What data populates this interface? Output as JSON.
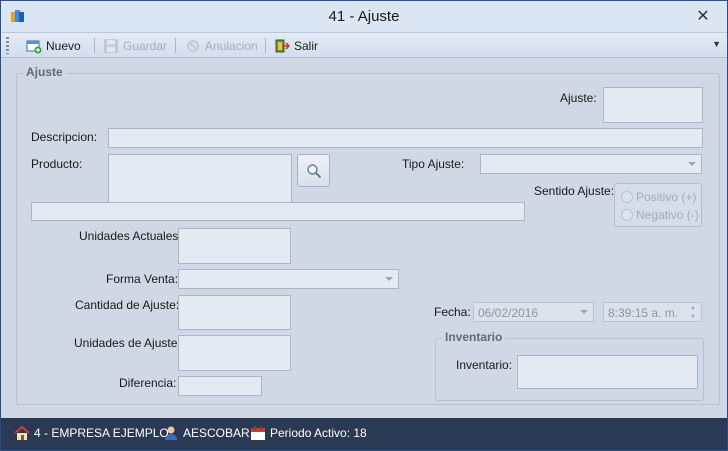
{
  "window": {
    "title": "41 - Ajuste",
    "close_glyph": "✕"
  },
  "toolbar": {
    "nuevo": "Nuevo",
    "guardar": "Guardar",
    "anulacion": "Anulacion",
    "salir": "Salir",
    "overflow_glyph": "▼"
  },
  "form": {
    "group_title": "Ajuste",
    "ajuste_label": "Ajuste:",
    "descripcion_label": "Descripcion:",
    "producto_label": "Producto:",
    "tipo_ajuste_label": "Tipo Ajuste:",
    "sentido_ajuste_label": "Sentido Ajuste:",
    "positivo_label": "Positivo (+)",
    "negativo_label": "Negativo (-)",
    "unidades_actuales_label": "Unidades Actuales:",
    "forma_venta_label": "Forma Venta:",
    "cantidad_ajuste_label": "Cantidad de Ajuste:",
    "unidades_ajuste_label": "Unidades de Ajuste:",
    "diferencia_label": "Diferencia:",
    "fecha_label": "Fecha:",
    "fecha_value": "06/02/2016",
    "hora_value": "8:39:15 a. m.",
    "inventario_group_title": "Inventario",
    "inventario_label": "Inventario:"
  },
  "status": {
    "empresa": "4 - EMPRESA EJEMPLO",
    "usuario": "AESCOBAR",
    "periodo": "Periodo Activo: 18"
  },
  "colors": {
    "window_bg": "#cfd8e4",
    "statusbar_bg": "#2a3a55",
    "field_bg": "#e4eaf2"
  }
}
